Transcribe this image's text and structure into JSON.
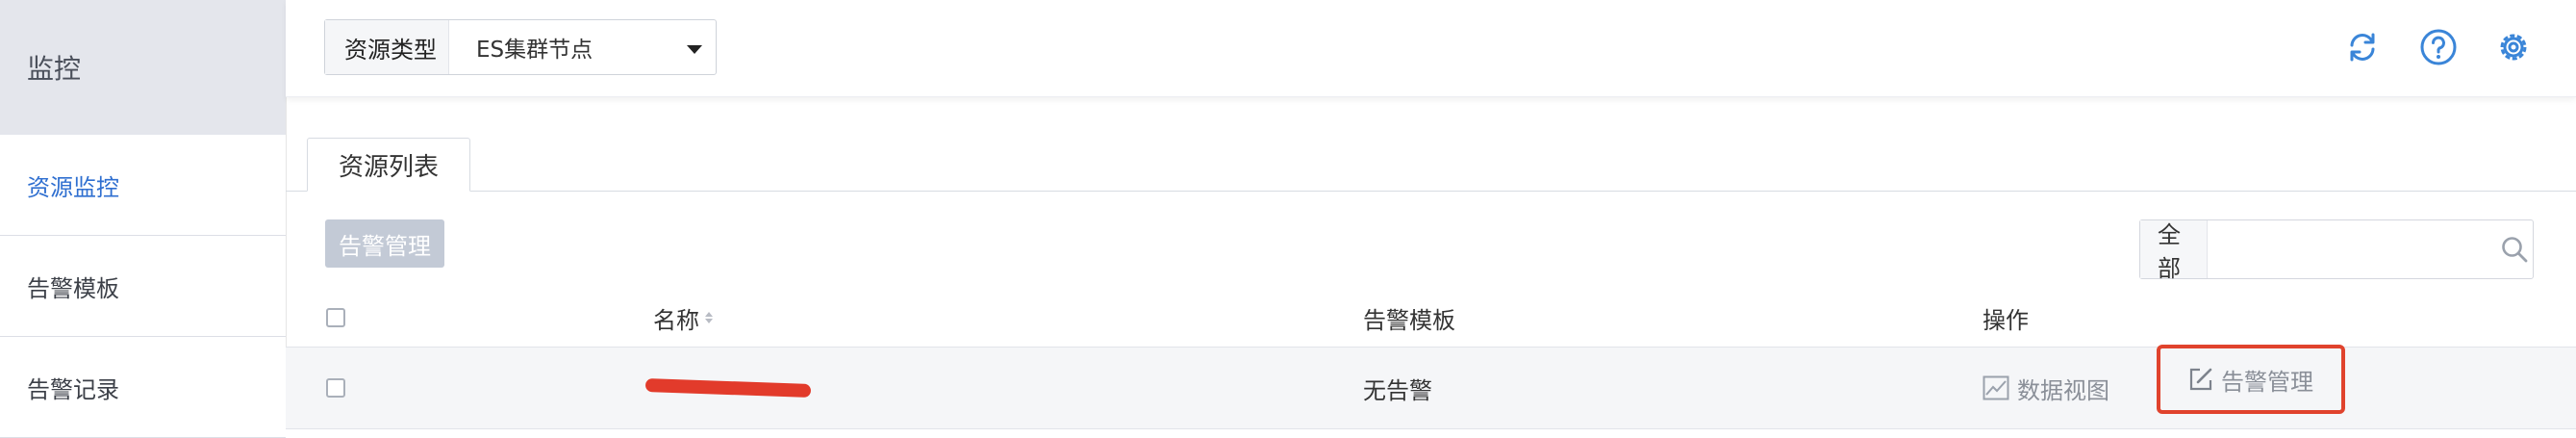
{
  "sidebar": {
    "title": "监控",
    "items": [
      {
        "label": "资源监控",
        "active": true
      },
      {
        "label": "告警模板",
        "active": false
      },
      {
        "label": "告警记录",
        "active": false
      }
    ]
  },
  "topbar": {
    "resource_type_label": "资源类型",
    "resource_type_value": "ES集群节点",
    "icons": [
      "refresh-icon",
      "help-icon",
      "settings-icon"
    ]
  },
  "tabs": [
    {
      "label": "资源列表"
    }
  ],
  "toolbar": {
    "alarm_manage_label": "告警管理",
    "search_scope": "全部",
    "search_placeholder": ""
  },
  "table": {
    "columns": [
      "名称",
      "告警模板",
      "操作"
    ],
    "rows": [
      {
        "name": "",
        "template": "无告警",
        "actions": [
          "数据视图",
          "告警管理"
        ]
      }
    ]
  },
  "colors": {
    "accent": "#2f6fd0",
    "highlight": "#e0432d",
    "disabled_button": "#c3cad6"
  }
}
